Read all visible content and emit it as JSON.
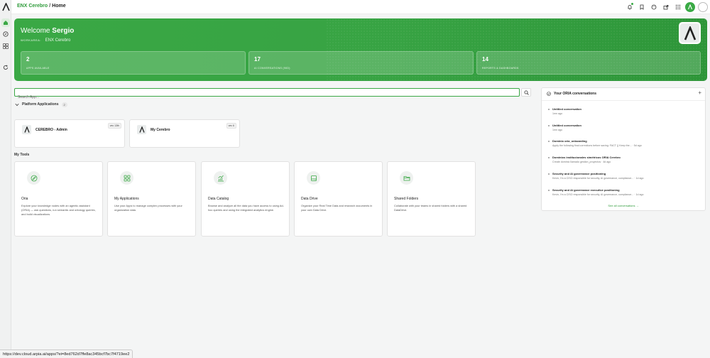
{
  "breadcrumb": {
    "org": "ENX Cerebro",
    "separator": "/",
    "page": "Home"
  },
  "hero": {
    "welcome_prefix": "Welcome",
    "user_name": "Sergio",
    "workarea_label": "WORKAREA:",
    "workarea_value": "ENX Cerebro",
    "stats": [
      {
        "value": "2",
        "label": "APPS AVAILABLE"
      },
      {
        "value": "17",
        "label": "AI CONVERSATIONS (90D)"
      },
      {
        "value": "14",
        "label": "REPORTS & DASHBOARDS"
      }
    ]
  },
  "search": {
    "placeholder": "Search App..."
  },
  "platform": {
    "title": "Platform Applications",
    "count": "2",
    "apps": [
      {
        "name": "CEREBRO - Admin",
        "version": "vec 13th"
      },
      {
        "name": "My Cerebro",
        "version": "vec 6"
      }
    ]
  },
  "my_tools": {
    "title": "My Tools",
    "items": [
      {
        "name": "Oria",
        "icon": "compass-icon",
        "desc": "Explore your knowledge nodes with an agentic assistant (ORIA) — ask questions, run semantic and ontology queries, and build visualizations."
      },
      {
        "name": "My Applications",
        "icon": "grid-icon",
        "desc": "Use your Apps to manage complex processes with your organization data."
      },
      {
        "name": "Data Catalog",
        "icon": "chart-icon",
        "desc": "Browse and analyze all the data you have access to using Ad-hoc queries and using the integrated analytics engine."
      },
      {
        "name": "Data Drive",
        "icon": "drive-icon",
        "desc": "Organize your Real Time Data and research documents in your own Data Drive."
      },
      {
        "name": "Shared Folders",
        "icon": "folder-icon",
        "desc": "Collaborate with your teams in shared folders with a shared DataDrive."
      }
    ]
  },
  "conversations": {
    "title": "Your ORIA conversations",
    "items": [
      {
        "title": "Untitled conversation",
        "sub": "1mn ago"
      },
      {
        "title": "Untitled conversation",
        "sub": "1mn ago"
      },
      {
        "title": "Dominio oria_onboarding",
        "sub": "Apply the following final corrections before saving: FACT () Keep the... · 5d ago"
      },
      {
        "title": "Dominios institucionales simétricos ORIA Cerebro",
        "sub": "Create dominio llamado gestion_proyectos · 4d ago"
      },
      {
        "title": "Security and AI governance positioning",
        "sub": "Kevin, I'm a CISO responsible for security, AI governance, compliance... · 1d ago"
      },
      {
        "title": "Security and AI governance executive positioning",
        "sub": "Kevin, I'm a CISO responsible for security, AI governance, compliance... · 1d ago"
      }
    ],
    "see_all": "See all conversations →"
  },
  "status_url": "https://dev.cloud.arpia.ai/apps/?ei=8ed762d7ffe8ac345bcf7bc7f4719ee2",
  "colors": {
    "accent": "#3aa845"
  }
}
